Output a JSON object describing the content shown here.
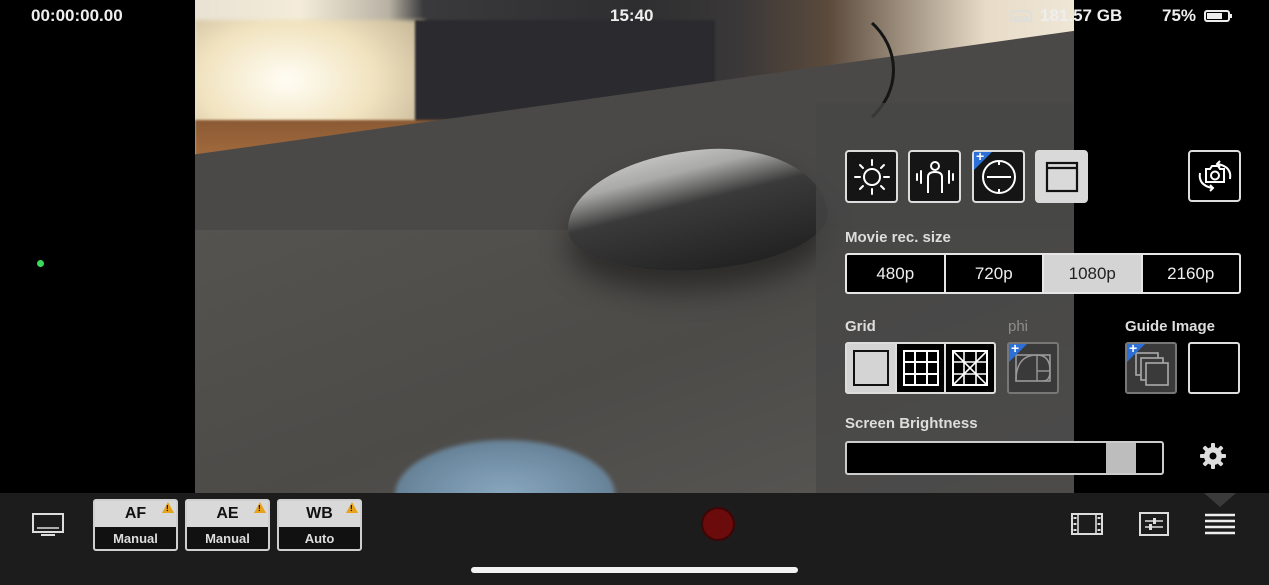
{
  "status_bar": {
    "timecode": "00:00:00.00",
    "clock": "15:40",
    "storage": "181.57 GB",
    "battery": "75%",
    "battery_level": 0.75
  },
  "panel": {
    "tools": [
      {
        "name": "exposure-icon",
        "active": false
      },
      {
        "name": "stabilization-icon",
        "active": false
      },
      {
        "name": "timer-icon",
        "active": false,
        "plus": true
      },
      {
        "name": "frame-icon",
        "active": true
      }
    ],
    "movie_size_label": "Movie rec. size",
    "movie_sizes": [
      "480p",
      "720p",
      "1080p",
      "2160p"
    ],
    "movie_size_selected": "1080p",
    "grid_label": "Grid",
    "phi_label": "phi",
    "guide_image_label": "Guide Image",
    "screen_brightness_label": "Screen Brightness",
    "screen_brightness_level": 0.91
  },
  "bottom_bar": {
    "af": {
      "title": "AF",
      "value": "Manual"
    },
    "ae": {
      "title": "AE",
      "value": "Manual"
    },
    "wb": {
      "title": "WB",
      "value": "Auto"
    }
  },
  "colors": {
    "record": "#6b0b0b",
    "warning": "#e6a21a",
    "plus_badge": "#2c6fd6",
    "rec_indicator": "#3adb5a"
  }
}
